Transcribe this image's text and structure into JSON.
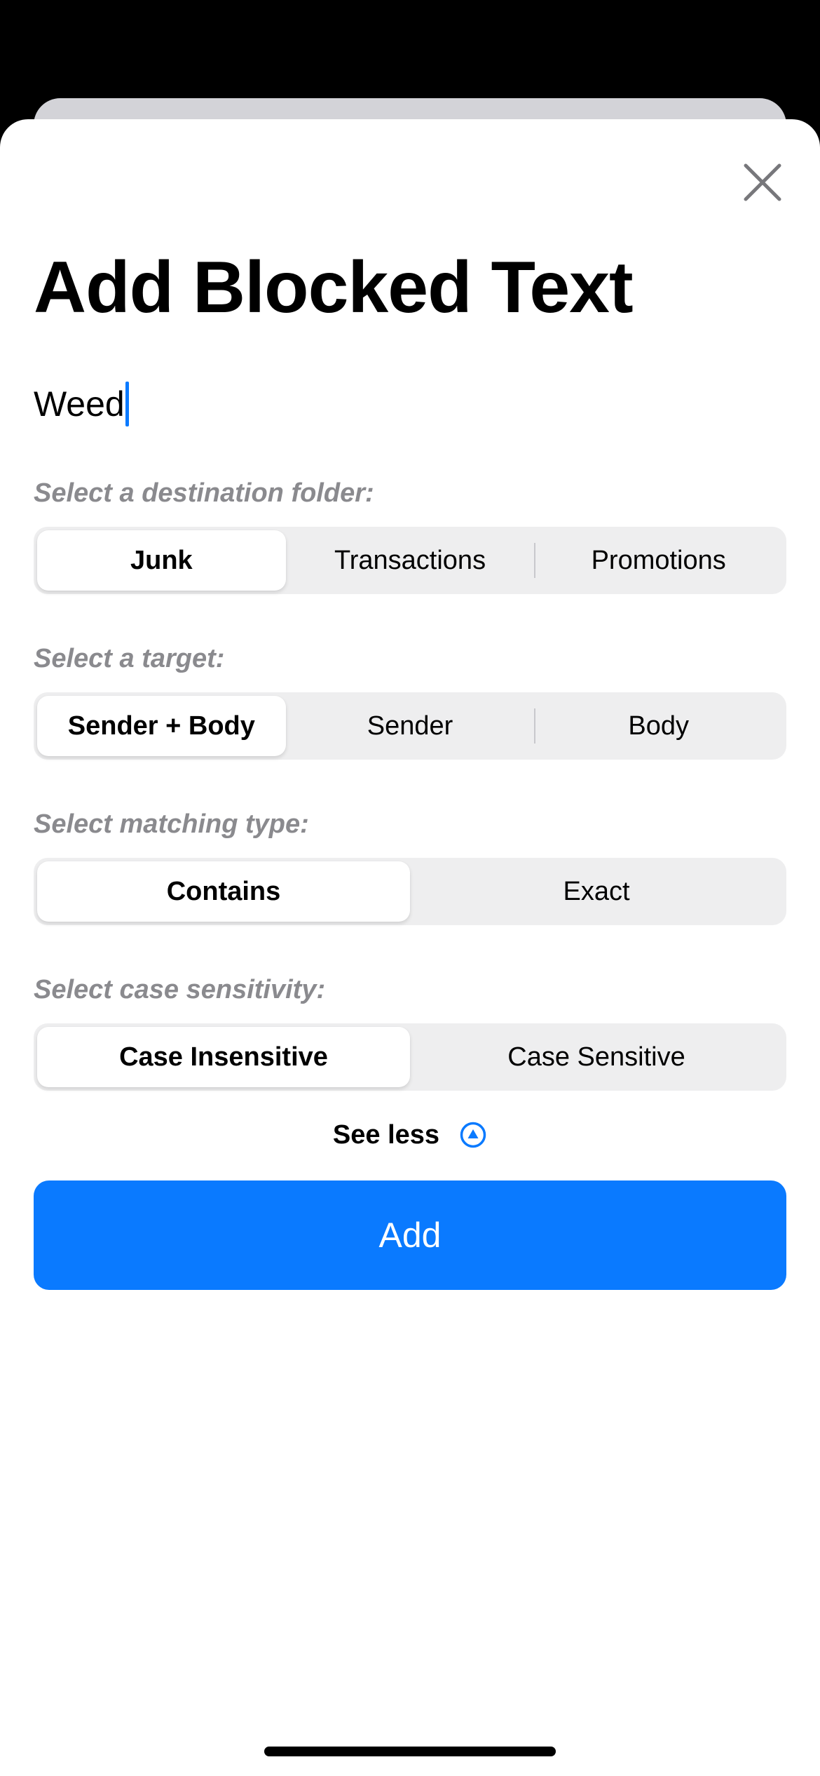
{
  "sheet": {
    "title": "Add Blocked Text",
    "close_icon": "close-icon"
  },
  "text_field": {
    "value": "Weed",
    "caret_color": "#0a7aff"
  },
  "destination": {
    "label": "Select a destination folder:",
    "options": [
      "Junk",
      "Transactions",
      "Promotions"
    ],
    "selected": "Junk"
  },
  "target": {
    "label": "Select a target:",
    "options": [
      "Sender + Body",
      "Sender",
      "Body"
    ],
    "selected": "Sender + Body"
  },
  "matching": {
    "label": "Select matching type:",
    "options": [
      "Contains",
      "Exact"
    ],
    "selected": "Contains"
  },
  "case_sensitivity": {
    "label": "Select case sensitivity:",
    "options": [
      "Case Insensitive",
      "Case Sensitive"
    ],
    "selected": "Case Insensitive"
  },
  "see_less": {
    "label": "See less",
    "icon": "chevron-up-circle-icon"
  },
  "add_button": {
    "label": "Add",
    "color": "#0a7aff"
  },
  "colors": {
    "accent": "#0a7aff",
    "label_gray": "#8a8a8e",
    "segment_bg": "#eeeeef"
  }
}
